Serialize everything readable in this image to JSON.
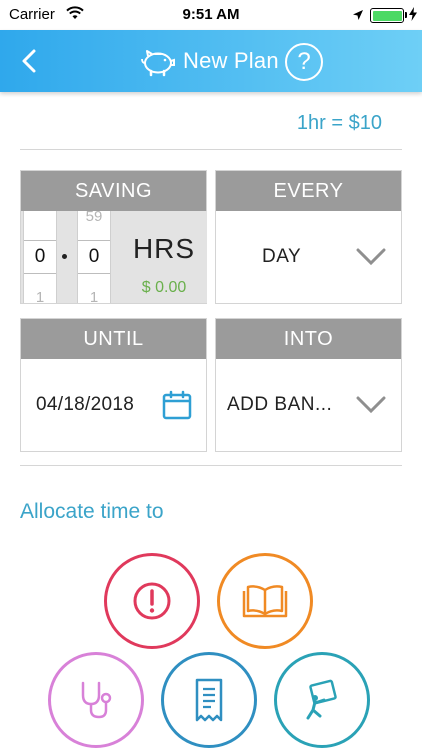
{
  "status_bar": {
    "carrier": "Carrier",
    "time": "9:51 AM"
  },
  "header": {
    "title": "New Plan",
    "help_label": "?",
    "back_icon": "chevron-left-icon",
    "logo_icon": "piggy-bank-icon"
  },
  "rate": "1hr = $10",
  "saving": {
    "label": "SAVING",
    "hours": {
      "above": "",
      "selected": "0",
      "below": "1"
    },
    "minutes": {
      "above": "59",
      "selected": "0",
      "below": "1"
    },
    "unit": "HRS",
    "amount": "$ 0.00"
  },
  "every": {
    "label": "EVERY",
    "value": "DAY"
  },
  "until": {
    "label": "UNTIL",
    "value": "04/18/2018"
  },
  "into": {
    "label": "INTO",
    "value": "ADD BAN..."
  },
  "allocate_heading": "Allocate time to",
  "categories": [
    {
      "icon": "alert-icon",
      "color": "#e0395c"
    },
    {
      "icon": "book-icon",
      "color": "#f08a24"
    },
    {
      "icon": "stethoscope-icon",
      "color": "#d881d8"
    },
    {
      "icon": "receipt-icon",
      "color": "#2f8fc1"
    },
    {
      "icon": "mover-icon",
      "color": "#2aa2b6"
    }
  ],
  "colors": {
    "header_start": "#2fa8ec",
    "header_end": "#6ecff6",
    "accent": "#3ba4c9",
    "card_header": "#9b9b9b",
    "money": "#6ab04c"
  }
}
